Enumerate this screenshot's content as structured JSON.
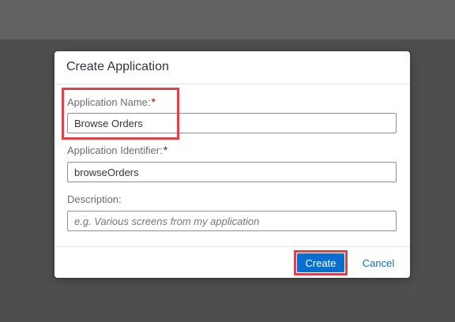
{
  "dialog": {
    "title": "Create Application",
    "fields": [
      {
        "label": "Application Name:",
        "required_marker": "*",
        "value": "Browse Orders",
        "placeholder": ""
      },
      {
        "label": "Application Identifier:",
        "required_marker": "*",
        "value": "browseOrders",
        "placeholder": ""
      },
      {
        "label": "Description:",
        "value": "",
        "placeholder": "e.g. Various screens from my application"
      }
    ],
    "buttons": {
      "create_label": "Create",
      "cancel_label": "Cancel"
    }
  },
  "colors": {
    "accent": "#0a6ed1",
    "required": "#bb0000",
    "highlight": "#e53f4a",
    "backdrop": "#4e4e4e"
  }
}
